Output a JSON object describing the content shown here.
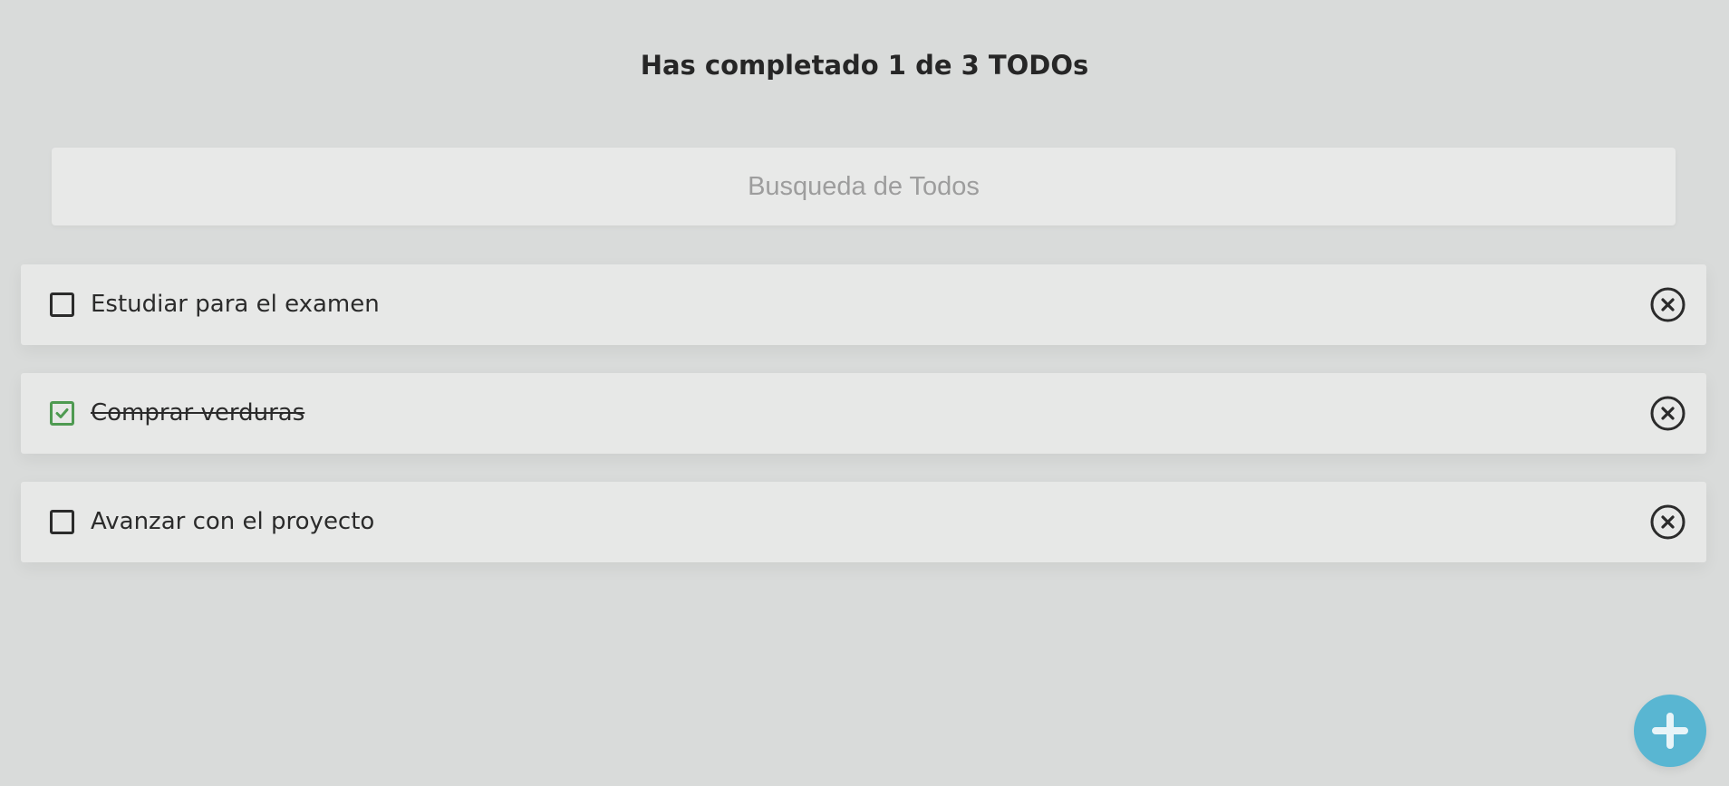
{
  "header": {
    "title": "Has completado 1 de 3 TODOs"
  },
  "search": {
    "placeholder": "Busqueda de Todos",
    "value": ""
  },
  "todos": [
    {
      "text": "Estudiar para el examen",
      "completed": false
    },
    {
      "text": "Comprar verduras",
      "completed": true
    },
    {
      "text": "Avanzar con el proyecto",
      "completed": false
    }
  ],
  "icons": {
    "checkbox": "square-checkbox-icon",
    "checked": "check-icon",
    "delete": "x-circle-icon",
    "add": "plus-icon"
  },
  "colors": {
    "background": "#d9dbda",
    "card": "#e7e8e7",
    "text": "#2b2b2b",
    "completed_check": "#4e9a51",
    "fab": "#59b6d2"
  }
}
